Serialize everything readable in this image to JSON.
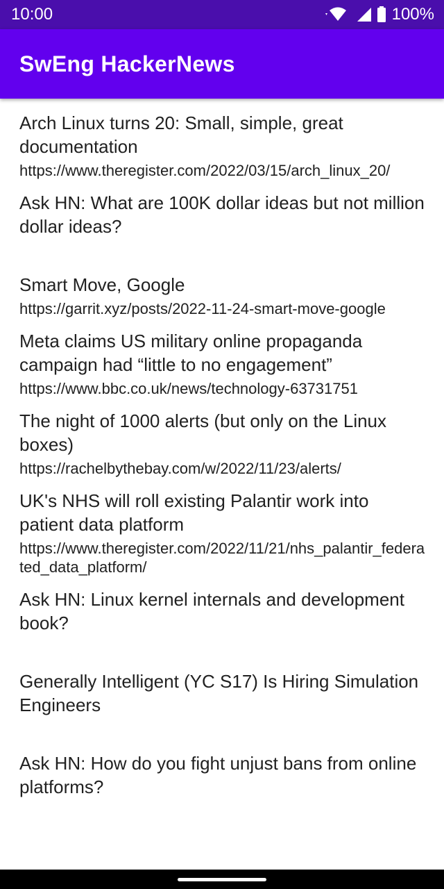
{
  "status_bar": {
    "time": "10:00",
    "battery": "100%",
    "icons": [
      "wifi-icon",
      "signal-icon",
      "battery-icon"
    ]
  },
  "app_bar": {
    "title": "SwEng HackerNews"
  },
  "colors": {
    "status_bar": "#4a0eac",
    "app_bar": "#6200ee",
    "background": "#ffffff"
  },
  "stories": [
    {
      "title": "Arch Linux turns 20: Small, simple, great documentation",
      "url": "https://www.theregister.com/2022/03/15/arch_linux_20/"
    },
    {
      "title": "Ask HN: What are 100K dollar ideas but not million dollar ideas?",
      "url": ""
    },
    {
      "title": "Smart Move, Google",
      "url": "https://garrit.xyz/posts/2022-11-24-smart-move-google"
    },
    {
      "title": "Meta claims US military online propaganda campaign had “little to no engagement”",
      "url": "https://www.bbc.co.uk/news/technology-63731751"
    },
    {
      "title": "The night of 1000 alerts (but only on the Linux boxes)",
      "url": "https://rachelbythebay.com/w/2022/11/23/alerts/"
    },
    {
      "title": "UK's NHS will roll existing Palantir work into patient data platform",
      "url": "https://www.theregister.com/2022/11/21/nhs_palantir_federated_data_platform/"
    },
    {
      "title": "Ask HN: Linux kernel internals and development book?",
      "url": ""
    },
    {
      "title": "Generally Intelligent (YC S17) Is Hiring Simulation Engineers",
      "url": ""
    },
    {
      "title": "Ask HN: How do you fight unjust bans from online platforms?",
      "url": ""
    }
  ]
}
